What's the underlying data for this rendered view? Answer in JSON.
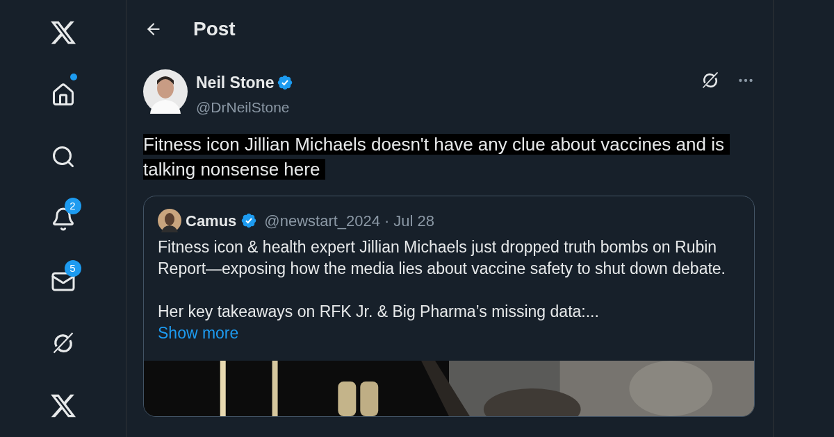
{
  "nav": [
    {
      "kind": "logo",
      "dot": false
    },
    {
      "kind": "home",
      "dot": true
    },
    {
      "kind": "search",
      "dot": false
    },
    {
      "kind": "bell",
      "dot": false,
      "count": "2"
    },
    {
      "kind": "mail",
      "dot": false,
      "count": "5"
    },
    {
      "kind": "grok",
      "dot": false
    },
    {
      "kind": "logo",
      "dot": false
    }
  ],
  "header": {
    "title": "Post"
  },
  "post": {
    "author": "Neil Stone",
    "verified": true,
    "handle": "@DrNeilStone",
    "text": "Fitness icon Jillian Michaels doesn't have any clue about vaccines and is talking nonsense here",
    "highlighted": true,
    "quote": {
      "author": "Camus",
      "verified": true,
      "handle": "@newstart_2024",
      "separator": "·",
      "date": "Jul 28",
      "paragraphs": [
        "Fitness icon & health expert Jillian Michaels just dropped truth bombs on Rubin Report—exposing how the media lies about vaccine safety to shut down debate.",
        "Her key takeaways on RFK Jr. & Big Pharma’s missing data:..."
      ],
      "show_more": "Show more"
    }
  }
}
